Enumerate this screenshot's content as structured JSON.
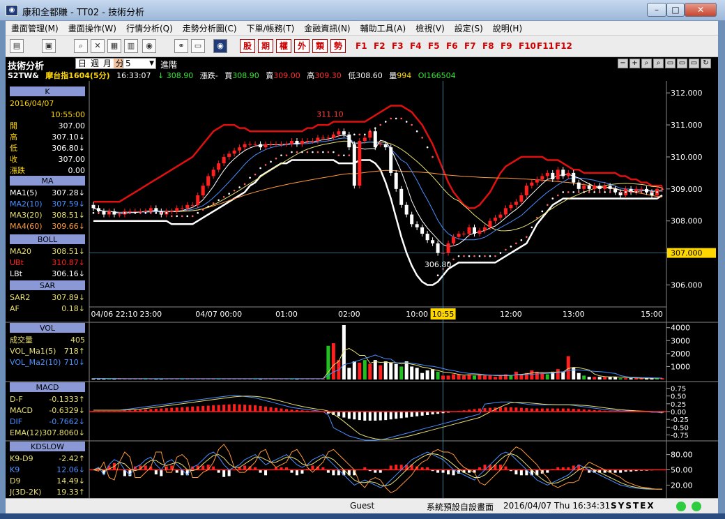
{
  "window": {
    "title": "康和全都賺 - TT02 - 技術分析",
    "minimize": "–",
    "maximize": "□",
    "close": "✕"
  },
  "menu": [
    "畫面管理(M)",
    "畫面操作(W)",
    "行情分析(Q)",
    "走勢分析圖(C)",
    "下單/帳務(T)",
    "金融資訊(N)",
    "輔助工具(A)",
    "檢視(V)",
    "設定(S)",
    "說明(H)"
  ],
  "toolbar": {
    "red_buttons": [
      "股",
      "期",
      "權",
      "外",
      "類",
      "勢"
    ],
    "fkeys": [
      "F1",
      "F2",
      "F3",
      "F4",
      "F5",
      "F6",
      "F7",
      "F8",
      "F9",
      "F10",
      "F11",
      "F12"
    ]
  },
  "header": {
    "title": "技術分析",
    "tabs": [
      "日",
      "週",
      "月",
      "分"
    ],
    "period": "5",
    "advanced": "進階",
    "symbol": "S2TW&",
    "name": "摩台指1604(5分)",
    "time": "16:33:07",
    "arrow": "↓",
    "last": "308.90",
    "change_label": "漲跌-",
    "bid_label": "買",
    "bid": "308.90",
    "ask_label": "賣",
    "ask": "309.00",
    "high_label": "高",
    "high": "309.30",
    "low_label": "低",
    "low": "308.60",
    "vol_label": "量",
    "vol": "994",
    "oi_label": "OI",
    "oi": "166504",
    "right_buttons": [
      "−",
      "+",
      "⌕",
      "⌕",
      "▭",
      "▭",
      "▭",
      "↻"
    ]
  },
  "panels": {
    "k": {
      "title": "K",
      "date": "2016/04/07",
      "time": "10:55:00",
      "rows": [
        {
          "label": "開",
          "value": "307.00"
        },
        {
          "label": "高",
          "value": "307.10↓"
        },
        {
          "label": "低",
          "value": "306.80↓"
        },
        {
          "label": "收",
          "value": "307.00"
        },
        {
          "label": "漲跌",
          "value": "0.00"
        }
      ]
    },
    "ma": {
      "title": "MA",
      "rows": [
        {
          "label": "MA1(5)",
          "value": "307.28↓",
          "color": "#ffffff"
        },
        {
          "label": "MA2(10)",
          "value": "307.59↓",
          "color": "#4a90ff"
        },
        {
          "label": "MA3(20)",
          "value": "308.51↓",
          "color": "#e8e070"
        },
        {
          "label": "MA4(60)",
          "value": "309.66↓",
          "color": "#ff9a3c"
        }
      ]
    },
    "boll": {
      "title": "BOLL",
      "rows": [
        {
          "label": "MA20",
          "value": "308.51↓",
          "color": "#e8e070"
        },
        {
          "label": "UBt",
          "value": "310.87↓",
          "color": "#ff2020"
        },
        {
          "label": "LBt",
          "value": "306.16↓",
          "color": "#ffffff"
        }
      ]
    },
    "sar": {
      "title": "SAR",
      "rows": [
        {
          "label": "SAR2",
          "value": "307.89↓",
          "color": "#e8e070"
        },
        {
          "label": "AF",
          "value": "0.18↓",
          "color": "#e8e070"
        }
      ]
    },
    "vol": {
      "title": "VOL",
      "rows": [
        {
          "label": "成交量",
          "value": "405",
          "color": "#e8e070"
        },
        {
          "label": "VOL_Ma1(5)",
          "value": "718↑",
          "color": "#e8e070"
        },
        {
          "label": "VOL_Ma2(10)",
          "value": "710↓",
          "color": "#4a90ff"
        }
      ]
    },
    "macd": {
      "title": "MACD",
      "rows": [
        {
          "label": "D-F",
          "value": "-0.1333↑",
          "color": "#e8e070"
        },
        {
          "label": "MACD",
          "value": "-0.6329↓",
          "color": "#e8e070"
        },
        {
          "label": "DIF",
          "value": "-0.7662↓",
          "color": "#4a90ff"
        },
        {
          "label": "EMA(12)",
          "value": "307.8060↓",
          "color": "#e8e070"
        }
      ]
    },
    "kd": {
      "title": "KDSLOW",
      "rows": [
        {
          "label": "K9-D9",
          "value": "-2.42↑",
          "color": "#e8e070"
        },
        {
          "label": "K9",
          "value": "12.06↓",
          "color": "#4a90ff"
        },
        {
          "label": "D9",
          "value": "14.49↓",
          "color": "#e8e070"
        },
        {
          "label": "J(3D-2K)",
          "value": "19.33↑",
          "color": "#e8e070"
        }
      ]
    }
  },
  "chart_data": {
    "type": "candlestick",
    "price_ticks": [
      "312.000",
      "311.000",
      "310.000",
      "309.000",
      "308.000",
      "307.000",
      "306.000"
    ],
    "price_ylim": [
      305.4,
      312.2
    ],
    "price_current": "307.000",
    "time_ticks": [
      "04/06 22:10",
      "23:00",
      "04/07 00:00",
      "01:00",
      "02:00",
      "10:00",
      "10:55",
      "12:00",
      "13:00",
      "15:00"
    ],
    "cursor_time": "10:55",
    "annot_high": "311.10",
    "annot_low": "306.80",
    "vol_ticks": [
      "4000",
      "3000",
      "2000",
      "1000"
    ],
    "macd_ticks": [
      "0.75",
      "0.50",
      "0.25",
      "0.00",
      "-0.25",
      "-0.50",
      "-0.75"
    ],
    "kd_ticks": [
      "80.00",
      "50.00",
      "20.00"
    ],
    "close": [
      308.4,
      308.3,
      308.2,
      308.3,
      308.2,
      308.2,
      308.3,
      308.3,
      308.3,
      308.3,
      308.3,
      308.4,
      308.3,
      308.2,
      308.3,
      308.3,
      308.4,
      308.4,
      308.5,
      308.5,
      308.8,
      309.1,
      309.4,
      309.6,
      309.8,
      310.0,
      310.1,
      310.2,
      310.3,
      310.4,
      310.4,
      310.4,
      310.3,
      310.4,
      310.4,
      310.4,
      310.4,
      310.4,
      310.5,
      310.4,
      310.5,
      310.5,
      310.5,
      310.6,
      310.6,
      310.6,
      310.7,
      310.8,
      310.7,
      310.3,
      309.1,
      310.5,
      310.6,
      310.8,
      310.3,
      310.4,
      310.3,
      309.5,
      309.0,
      308.5,
      308.2,
      307.9,
      307.8,
      307.6,
      307.4,
      307.3,
      307.0,
      307.0,
      307.3,
      307.5,
      307.6,
      307.6,
      307.8,
      307.6,
      307.7,
      307.8,
      308.0,
      308.1,
      308.2,
      308.4,
      308.5,
      308.6,
      308.8,
      309.1,
      309.2,
      309.3,
      309.4,
      309.5,
      309.3,
      309.6,
      309.4,
      309.5,
      309.2,
      309.0,
      309.1,
      309.0,
      309.1,
      309.0,
      309.1,
      309.0,
      308.9,
      308.8,
      309.0,
      308.9,
      309.0,
      309.0,
      308.9,
      308.8,
      309.0,
      309.0
    ],
    "open": [
      308.5,
      308.4,
      308.3,
      308.2,
      308.3,
      308.2,
      308.2,
      308.3,
      308.3,
      308.3,
      308.3,
      308.3,
      308.4,
      308.3,
      308.2,
      308.3,
      308.3,
      308.4,
      308.4,
      308.5,
      308.5,
      308.8,
      309.1,
      309.4,
      309.6,
      309.8,
      310.0,
      310.1,
      310.2,
      310.3,
      310.4,
      310.4,
      310.4,
      310.3,
      310.4,
      310.4,
      310.4,
      310.4,
      310.4,
      310.5,
      310.4,
      310.5,
      310.5,
      310.5,
      310.6,
      310.6,
      310.6,
      310.7,
      310.8,
      310.7,
      310.4,
      309.1,
      310.5,
      310.6,
      310.8,
      310.4,
      310.4,
      310.3,
      309.5,
      309.0,
      308.5,
      308.2,
      307.9,
      307.8,
      307.6,
      307.4,
      307.3,
      307.0,
      307.0,
      307.3,
      307.5,
      307.6,
      307.6,
      307.8,
      307.6,
      307.7,
      307.8,
      308.0,
      308.1,
      308.2,
      308.4,
      308.5,
      308.6,
      308.8,
      309.1,
      309.2,
      309.3,
      309.4,
      309.5,
      309.3,
      309.6,
      309.4,
      309.5,
      309.2,
      309.0,
      309.1,
      309.0,
      309.1,
      309.0,
      309.1,
      309.0,
      308.9,
      308.8,
      309.0,
      308.9,
      309.0,
      309.0,
      308.9,
      308.8,
      309.0
    ],
    "ub": [
      308.6,
      308.6,
      308.6,
      308.6,
      308.6,
      308.6,
      308.7,
      308.8,
      308.9,
      309.0,
      309.1,
      309.2,
      309.3,
      309.4,
      309.5,
      309.6,
      309.7,
      309.8,
      309.9,
      310.0,
      310.2,
      310.4,
      310.6,
      310.8,
      310.9,
      311.0,
      311.0,
      311.0,
      310.9,
      310.9,
      310.8,
      310.8,
      310.8,
      310.8,
      310.8,
      310.8,
      310.8,
      310.8,
      310.8,
      310.8,
      310.8,
      310.9,
      310.9,
      311.0,
      311.0,
      311.0,
      311.1,
      311.1,
      311.1,
      311.1,
      311.1,
      311.1,
      311.1,
      311.2,
      311.3,
      311.4,
      311.5,
      311.6,
      311.6,
      311.6,
      311.5,
      311.4,
      311.2,
      311.0,
      310.7,
      310.4,
      310.0,
      309.6,
      309.2,
      308.9,
      308.7,
      308.5,
      308.4,
      308.4,
      308.5,
      308.7,
      308.9,
      309.2,
      309.5,
      309.7,
      309.8,
      309.9,
      310.0,
      310.0,
      310.0,
      310.0,
      310.0,
      309.9,
      309.9,
      309.9,
      309.8,
      309.7,
      309.6,
      309.6,
      309.5,
      309.5,
      309.5,
      309.5,
      309.5,
      309.5,
      309.5,
      309.4,
      309.4,
      309.3,
      309.3,
      309.2,
      309.2,
      309.1,
      309.1,
      309.1
    ],
    "lb": [
      308.0,
      308.0,
      308.0,
      308.0,
      308.0,
      308.0,
      308.0,
      308.0,
      308.0,
      308.0,
      308.0,
      308.0,
      308.0,
      308.0,
      308.0,
      307.9,
      307.9,
      307.9,
      307.9,
      307.9,
      308.0,
      308.1,
      308.2,
      308.3,
      308.4,
      308.5,
      308.6,
      308.7,
      308.8,
      308.9,
      309.1,
      309.2,
      309.4,
      309.5,
      309.6,
      309.7,
      309.8,
      309.8,
      309.9,
      309.9,
      309.9,
      309.9,
      309.9,
      309.9,
      309.9,
      309.9,
      309.9,
      309.8,
      309.8,
      309.8,
      309.8,
      309.9,
      309.9,
      309.9,
      309.8,
      309.6,
      309.2,
      308.7,
      308.1,
      307.5,
      307.0,
      306.6,
      306.3,
      306.1,
      306.0,
      306.0,
      306.1,
      306.3,
      306.5,
      306.6,
      306.7,
      306.7,
      306.7,
      306.7,
      306.7,
      306.7,
      306.7,
      306.7,
      306.8,
      306.9,
      307.0,
      307.1,
      307.2,
      307.3,
      307.6,
      307.9,
      308.1,
      308.3,
      308.5,
      308.6,
      308.7,
      308.7,
      308.7,
      308.7,
      308.7,
      308.7,
      308.7,
      308.7,
      308.7,
      308.7,
      308.7,
      308.7,
      308.7,
      308.7,
      308.7,
      308.7,
      308.7,
      308.7,
      308.7,
      308.8
    ],
    "volume": [
      80,
      80,
      60,
      60,
      60,
      60,
      60,
      60,
      60,
      60,
      60,
      60,
      60,
      60,
      60,
      60,
      60,
      60,
      60,
      60,
      60,
      60,
      60,
      60,
      60,
      60,
      60,
      60,
      60,
      60,
      60,
      60,
      60,
      60,
      60,
      60,
      60,
      60,
      60,
      60,
      60,
      60,
      60,
      60,
      60,
      2600,
      2800,
      1500,
      4200,
      900,
      1400,
      1300,
      1500,
      1200,
      1500,
      1100,
      1400,
      1300,
      1200,
      1000,
      1400,
      1000,
      900,
      500,
      700,
      800,
      600,
      300,
      300,
      400,
      400,
      300,
      400,
      300,
      400,
      300,
      300,
      200,
      300,
      400,
      300,
      600,
      400,
      500,
      700,
      600,
      500,
      400,
      600,
      800,
      600,
      1800,
      900,
      500,
      300,
      200,
      200,
      200,
      200,
      200,
      200,
      100,
      100,
      100,
      100,
      100,
      100,
      100,
      100,
      100
    ],
    "macd_hist": [
      0.02,
      0.02,
      0.02,
      0.02,
      0.02,
      0.02,
      0.03,
      0.04,
      0.05,
      0.06,
      0.07,
      0.08,
      0.09,
      0.1,
      0.11,
      0.12,
      0.13,
      0.14,
      0.15,
      0.16,
      0.17,
      0.18,
      0.19,
      0.2,
      0.21,
      0.22,
      0.23,
      0.24,
      0.23,
      0.22,
      0.21,
      0.2,
      0.18,
      0.16,
      0.14,
      0.12,
      0.1,
      0.08,
      0.06,
      0.05,
      0.04,
      0.03,
      0.02,
      0.01,
      0.0,
      -0.05,
      -0.1,
      -0.14,
      -0.18,
      -0.22,
      -0.24,
      -0.26,
      -0.28,
      -0.28,
      -0.28,
      -0.27,
      -0.26,
      -0.24,
      -0.22,
      -0.2,
      -0.18,
      -0.16,
      -0.14,
      -0.12,
      -0.1,
      -0.08,
      -0.06,
      -0.04,
      -0.02,
      0.0,
      0.02,
      0.04,
      0.06,
      0.08,
      0.1,
      0.11,
      0.12,
      0.13,
      0.14,
      0.14,
      0.14,
      0.13,
      0.12,
      0.11,
      0.1,
      0.1,
      0.1,
      0.1,
      0.1,
      0.1,
      0.1,
      0.1,
      0.09,
      0.08,
      0.07,
      0.06,
      0.05,
      0.04,
      0.03,
      0.02,
      0.02,
      0.01,
      0.01,
      0.01,
      0.0,
      0.0,
      0.0,
      -0.01,
      -0.01,
      -0.02
    ],
    "k9": [
      50,
      55,
      40,
      60,
      70,
      65,
      50,
      40,
      55,
      60,
      70,
      75,
      60,
      50,
      65,
      70,
      60,
      50,
      40,
      55,
      60,
      70,
      80,
      85,
      75,
      60,
      50,
      55,
      60,
      70,
      75,
      80,
      70,
      60,
      65,
      70,
      75,
      80,
      70,
      60,
      55,
      60,
      70,
      75,
      80,
      70,
      60,
      50,
      40,
      30,
      20,
      25,
      30,
      25,
      20,
      15,
      20,
      30,
      40,
      50,
      60,
      70,
      75,
      80,
      85,
      80,
      75,
      70,
      60,
      50,
      45,
      40,
      35,
      30,
      40,
      50,
      60,
      70,
      80,
      85,
      80,
      70,
      60,
      50,
      40,
      30,
      25,
      20,
      25,
      30,
      35,
      40,
      50,
      60,
      55,
      50,
      45,
      40,
      35,
      30,
      25,
      20,
      18,
      15,
      14,
      13,
      12,
      12,
      12,
      12
    ]
  }
}
